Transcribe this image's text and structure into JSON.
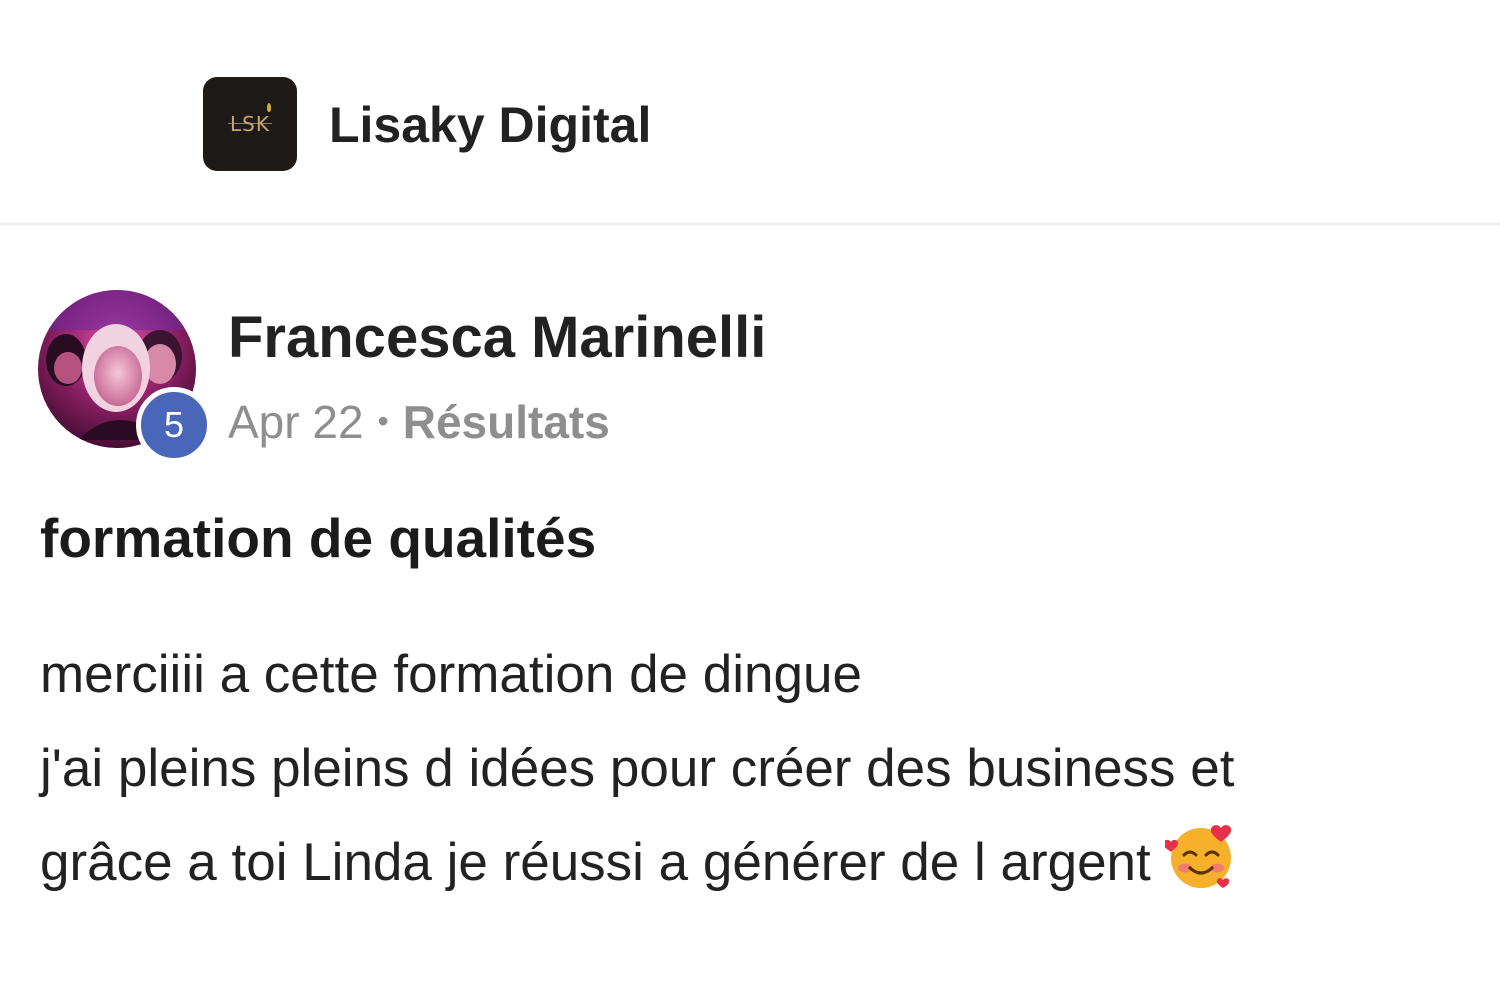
{
  "group": {
    "name": "Lisaky Digital",
    "logo_text": "LSK",
    "logo_icon": "lisaky-logo-icon"
  },
  "post": {
    "author": {
      "name": "Francesca Marinelli",
      "level": "5",
      "avatar_icon": "user-avatar"
    },
    "date": "Apr 22",
    "separator": "•",
    "category": "Résultats",
    "title": "formation de qualités",
    "body": {
      "line1": "merciiii a cette formation de dingue",
      "line2": "j'ai pleins pleins d idées pour créer des business et",
      "line3": "grâce a toi Linda je réussi a générer de l argent"
    },
    "emoji_icon": "smiling-face-with-hearts-emoji"
  },
  "colors": {
    "level_badge": "#4a66b8",
    "logo_bg": "#1e1a17",
    "logo_accent": "#c9a56a",
    "meta_text": "#8e8e8e"
  }
}
